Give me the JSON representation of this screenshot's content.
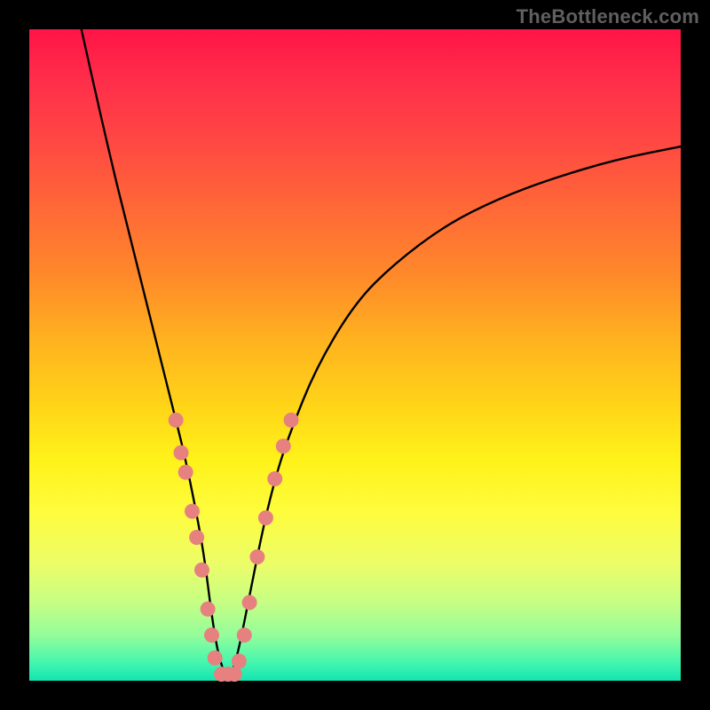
{
  "watermark": "TheBottleneck.com",
  "colors": {
    "frame": "#000000",
    "curve": "#000000",
    "marker_fill": "#e6817f",
    "marker_stroke": "#c05d5a"
  },
  "chart_data": {
    "type": "line",
    "title": "",
    "xlabel": "",
    "ylabel": "",
    "xlim": [
      0,
      100
    ],
    "ylim": [
      0,
      100
    ],
    "grid": false,
    "legend": false,
    "series": [
      {
        "name": "bottleneck-curve",
        "x": [
          8,
          12,
          16,
          18,
          20,
          22,
          24,
          26,
          27,
          28,
          29,
          30,
          31,
          32,
          34,
          36,
          38,
          40,
          44,
          50,
          56,
          64,
          72,
          80,
          90,
          100
        ],
        "y": [
          100,
          82,
          66,
          58,
          50,
          42,
          34,
          24,
          18,
          10,
          4,
          1,
          1,
          4,
          14,
          24,
          32,
          38,
          48,
          58,
          64,
          70,
          74,
          77,
          80,
          82
        ]
      }
    ],
    "markers": {
      "name": "highlight-dots",
      "points": [
        {
          "x": 22.5,
          "y": 40
        },
        {
          "x": 23.3,
          "y": 35
        },
        {
          "x": 24.0,
          "y": 32
        },
        {
          "x": 25.0,
          "y": 26
        },
        {
          "x": 25.7,
          "y": 22
        },
        {
          "x": 26.5,
          "y": 17
        },
        {
          "x": 27.4,
          "y": 11
        },
        {
          "x": 28.0,
          "y": 7
        },
        {
          "x": 28.5,
          "y": 3.5
        },
        {
          "x": 29.5,
          "y": 1.0
        },
        {
          "x": 30.5,
          "y": 1.0
        },
        {
          "x": 31.5,
          "y": 1.0
        },
        {
          "x": 32.2,
          "y": 3
        },
        {
          "x": 33.0,
          "y": 7
        },
        {
          "x": 33.8,
          "y": 12
        },
        {
          "x": 35.0,
          "y": 19
        },
        {
          "x": 36.3,
          "y": 25
        },
        {
          "x": 37.7,
          "y": 31
        },
        {
          "x": 39.0,
          "y": 36
        },
        {
          "x": 40.2,
          "y": 40
        }
      ]
    }
  }
}
